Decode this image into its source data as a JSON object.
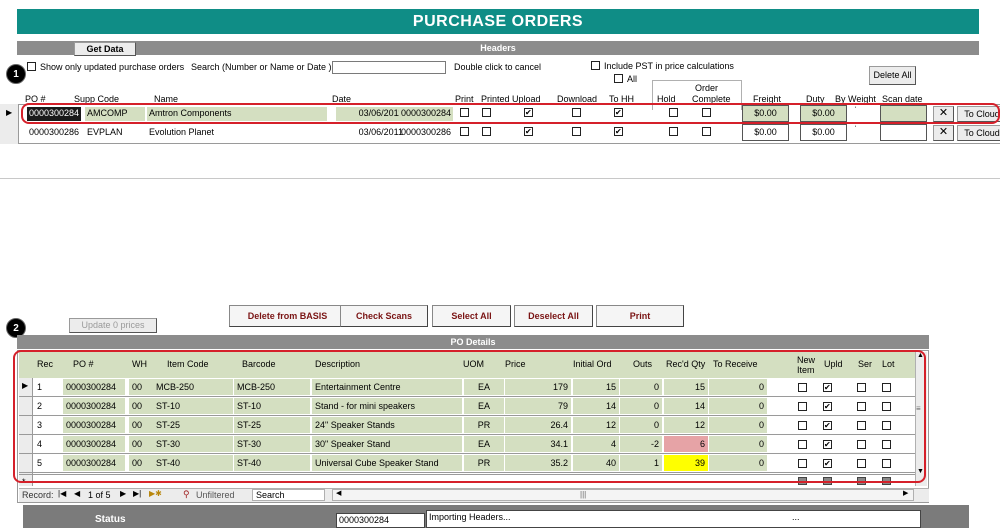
{
  "title": "PURCHASE ORDERS",
  "headers_section": {
    "bar_title": "Headers",
    "get_data_label": "Get Data",
    "show_updated_label": "Show only updated purchase orders",
    "search_label": "Search (Number or Name or Date )",
    "search_value": "",
    "double_click_hint": "Double click to cancel",
    "include_pst_label": "Include PST in price calculations",
    "all_label": "All",
    "delete_all_label": "Delete All",
    "badge": "1",
    "columns": {
      "po": "PO #",
      "supp": "Supp Code",
      "name": "Name",
      "date": "Date",
      "print": "Print",
      "printed": "Printed",
      "upload": "Upload",
      "download": "Download",
      "to_hh": "To HH",
      "hold": "Hold",
      "order_complete_1": "Order",
      "order_complete_2": "Complete",
      "freight": "Freight",
      "duty": "Duty",
      "by_weight": "By Weight",
      "scan_date": "Scan date"
    },
    "rows": [
      {
        "po": "0000300284",
        "supp": "AMCOMP",
        "name": "Amtron Components",
        "date": "03/06/2011",
        "po2": "0000300284",
        "freight": "$0.00",
        "duty": "$0.00",
        "to_cloud": "To Cloud",
        "upload": true,
        "to_hh": true
      },
      {
        "po": "0000300286",
        "supp": "EVPLAN",
        "name": "Evolution Planet",
        "date": "03/06/2011",
        "po2": "0000300286",
        "freight": "$0.00",
        "duty": "$0.00",
        "to_cloud": "To Cloud",
        "upload": true,
        "to_hh": true
      }
    ]
  },
  "details_section": {
    "badge": "2",
    "update_prices_label": "Update 0 prices",
    "buttons": {
      "delete_basis": "Delete from BASIS",
      "check_scans": "Check Scans",
      "select_all": "Select All",
      "deselect_all": "Deselect All",
      "print": "Print"
    },
    "bar_title": "PO Details",
    "columns": {
      "rec": "Rec",
      "po": "PO #",
      "wh": "WH",
      "item": "Item Code",
      "barcode": "Barcode",
      "desc": "Description",
      "uom": "UOM",
      "price": "Price",
      "initial": "Initial Ord",
      "outs": "Outs",
      "recd": "Rec'd Qty",
      "to_receive": "To Receive",
      "new_item_1": "New",
      "new_item_2": "Item",
      "upld": "Upld",
      "ser": "Ser",
      "lot": "Lot"
    },
    "rows": [
      {
        "rec": "1",
        "po": "0000300284",
        "wh": "00",
        "item": "MCB-250",
        "barcode": "MCB-250",
        "desc": "Entertainment Centre",
        "uom": "EA",
        "price": "179",
        "initial": "15",
        "outs": "0",
        "recd": "15",
        "to_receive": "0",
        "highlight": "none"
      },
      {
        "rec": "2",
        "po": "0000300284",
        "wh": "00",
        "item": "ST-10",
        "barcode": "ST-10",
        "desc": "Stand - for mini speakers",
        "uom": "EA",
        "price": "79",
        "initial": "14",
        "outs": "0",
        "recd": "14",
        "to_receive": "0",
        "highlight": "none"
      },
      {
        "rec": "3",
        "po": "0000300284",
        "wh": "00",
        "item": "ST-25",
        "barcode": "ST-25",
        "desc": "24\" Speaker Stands",
        "uom": "PR",
        "price": "26.4",
        "initial": "12",
        "outs": "0",
        "recd": "12",
        "to_receive": "0",
        "highlight": "none"
      },
      {
        "rec": "4",
        "po": "0000300284",
        "wh": "00",
        "item": "ST-30",
        "barcode": "ST-30",
        "desc": "30\" Speaker Stand",
        "uom": "EA",
        "price": "34.1",
        "initial": "4",
        "outs": "-2",
        "recd": "6",
        "to_receive": "0",
        "highlight": "red"
      },
      {
        "rec": "5",
        "po": "0000300284",
        "wh": "00",
        "item": "ST-40",
        "barcode": "ST-40",
        "desc": "Universal Cube Speaker Stand",
        "uom": "PR",
        "price": "35.2",
        "initial": "40",
        "outs": "1",
        "recd": "39",
        "to_receive": "0",
        "highlight": "yellow"
      }
    ],
    "record_nav": {
      "record_label": "Record:",
      "position": "1 of 5",
      "unfiltered": "Unfiltered",
      "search": "Search"
    }
  },
  "status": {
    "label": "Status",
    "po_value": "0000300284",
    "message": "Importing Headers...",
    "ellipsis": "..."
  },
  "colors": {
    "title_bg": "#0f8d86",
    "row_bg": "#d4dfc1",
    "highlight_red": "#e6a3a6",
    "highlight_yellow": "#ffff00",
    "outline": "#d5202a"
  }
}
